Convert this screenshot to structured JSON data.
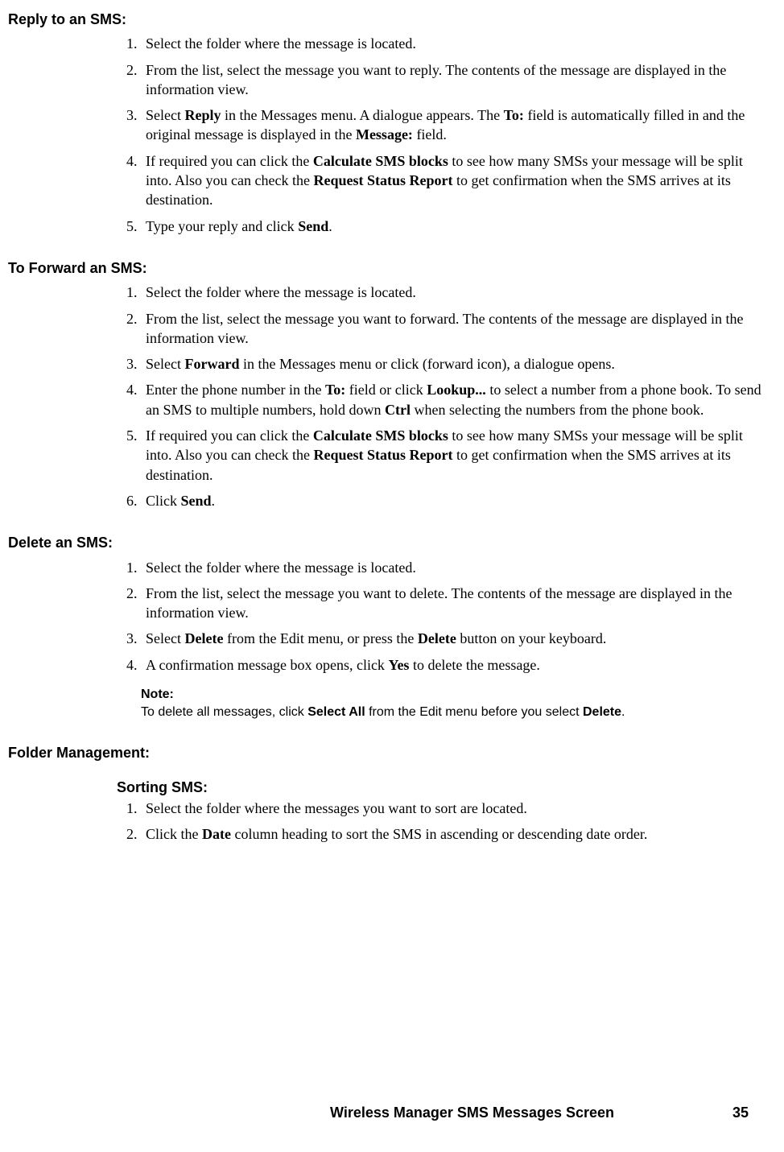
{
  "sections": {
    "reply": {
      "heading": "Reply to an SMS:",
      "step1": "Select the folder where the message is located.",
      "step2": "From the list, select the message you want to reply. The contents of the message are displayed in the information view.",
      "step3_a": "Select ",
      "step3_b": "Reply",
      "step3_c": " in the Messages menu. A dialogue appears. The ",
      "step3_d": "To:",
      "step3_e": " field is automatically filled in and the original message is displayed in the ",
      "step3_f": "Message:",
      "step3_g": " field.",
      "step4_a": "If required you can click the ",
      "step4_b": "Calculate SMS blocks",
      "step4_c": " to see how many SMSs your message will be split into. Also you can check the ",
      "step4_d": "Request Status Report",
      "step4_e": " to get confirmation when the SMS arrives at its destination.",
      "step5_a": "Type your reply and click ",
      "step5_b": "Send",
      "step5_c": "."
    },
    "forward": {
      "heading": "To Forward an SMS:",
      "step1": "Select the folder where the message is located.",
      "step2": "From the list, select the message you want to forward. The contents of the message are displayed in the information view.",
      "step3_a": "Select ",
      "step3_b": "Forward",
      "step3_c": " in the Messages menu or click (forward icon), a dialogue opens.",
      "step4_a": "Enter the phone number in the ",
      "step4_b": "To:",
      "step4_c": " field or click ",
      "step4_d": "Lookup...",
      "step4_e": " to select a number from a phone book. To send an SMS to multiple numbers, hold down ",
      "step4_f": "Ctrl",
      "step4_g": " when selecting the numbers from the phone book.",
      "step5_a": "If required you can click the ",
      "step5_b": "Calculate SMS blocks",
      "step5_c": " to see how many SMSs your message will be split into. Also you can check the ",
      "step5_d": "Request Status Report",
      "step5_e": " to get confirmation when the SMS arrives at its destination.",
      "step6_a": "Click ",
      "step6_b": "Send",
      "step6_c": "."
    },
    "delete": {
      "heading": "Delete an SMS:",
      "step1": "Select the folder where the message is located.",
      "step2": "From the list, select the message you want to delete. The contents of the message are displayed in the information view.",
      "step3_a": "Select ",
      "step3_b": "Delete",
      "step3_c": " from the Edit menu, or press the ",
      "step3_d": "Delete",
      "step3_e": " button on your keyboard.",
      "step4_a": "A confirmation message box opens, click ",
      "step4_b": "Yes",
      "step4_c": " to delete the message.",
      "note_label": "Note:",
      "note_a": "To delete all messages, click ",
      "note_b": "Select All",
      "note_c": " from the Edit menu before you select ",
      "note_d": "Delete",
      "note_e": "."
    },
    "folder": {
      "heading": "Folder Management:",
      "sub_heading": "Sorting SMS:",
      "step1": "Select the folder where the messages you want to sort are located.",
      "step2_a": "Click the ",
      "step2_b": "Date",
      "step2_c": " column heading to sort the SMS in ascending or descending date order."
    }
  },
  "footer": {
    "title": "Wireless Manager SMS Messages Screen",
    "page": "35"
  }
}
